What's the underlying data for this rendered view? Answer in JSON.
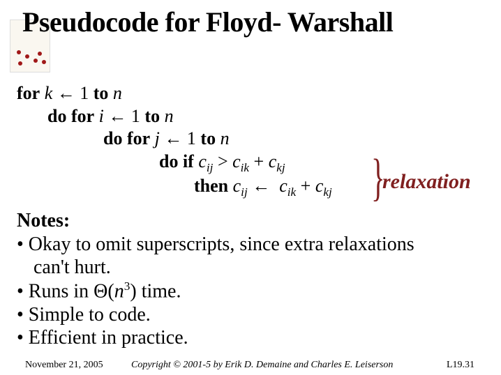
{
  "title": "Pseudocode for Floyd- Warshall",
  "code": {
    "line1": {
      "for": "for",
      "kvar": "k",
      "arrow": "←",
      "one": " 1",
      "to": "to",
      "nvar": "n"
    },
    "line2": {
      "do_for": "do for",
      "ivar": "i",
      "arrow": "←",
      "one": " 1",
      "to": "to",
      "nvar": "n"
    },
    "line3": {
      "do_for": "do for",
      "jvar": "j",
      "arrow": "←",
      "one": " 1",
      "to": "to",
      "nvar": "n"
    },
    "line4": {
      "do_if": "do if",
      "c1": "c",
      "ij": "ij",
      "gt": ">",
      "c2": "c",
      "ik": "ik",
      "plus": "+",
      "c3": "c",
      "kj": "kj"
    },
    "line5": {
      "then": "then",
      "c1": "c",
      "ij": "ij",
      "arrow": "←",
      "c2": "c",
      "ik": "ik",
      "plus": "+",
      "c3": "c",
      "kj": "kj"
    }
  },
  "brace": "}",
  "relaxation": "relaxation",
  "notes": {
    "heading": "Notes:",
    "b1a": "• Okay to omit superscripts, since extra relaxations",
    "b1b": "can't hurt.",
    "b2_pre": "• Runs in ",
    "b2_theta": "Θ(",
    "b2_n": "n",
    "b2_exp": "3",
    "b2_post": ") time.",
    "b3": "• Simple to code.",
    "b4": "• Efficient in practice."
  },
  "footer": {
    "date": "November 21, 2005",
    "copy": "Copyright © 2001-5 by Erik D. Demaine and Charles E. Leiserson",
    "page": "L19.31"
  }
}
